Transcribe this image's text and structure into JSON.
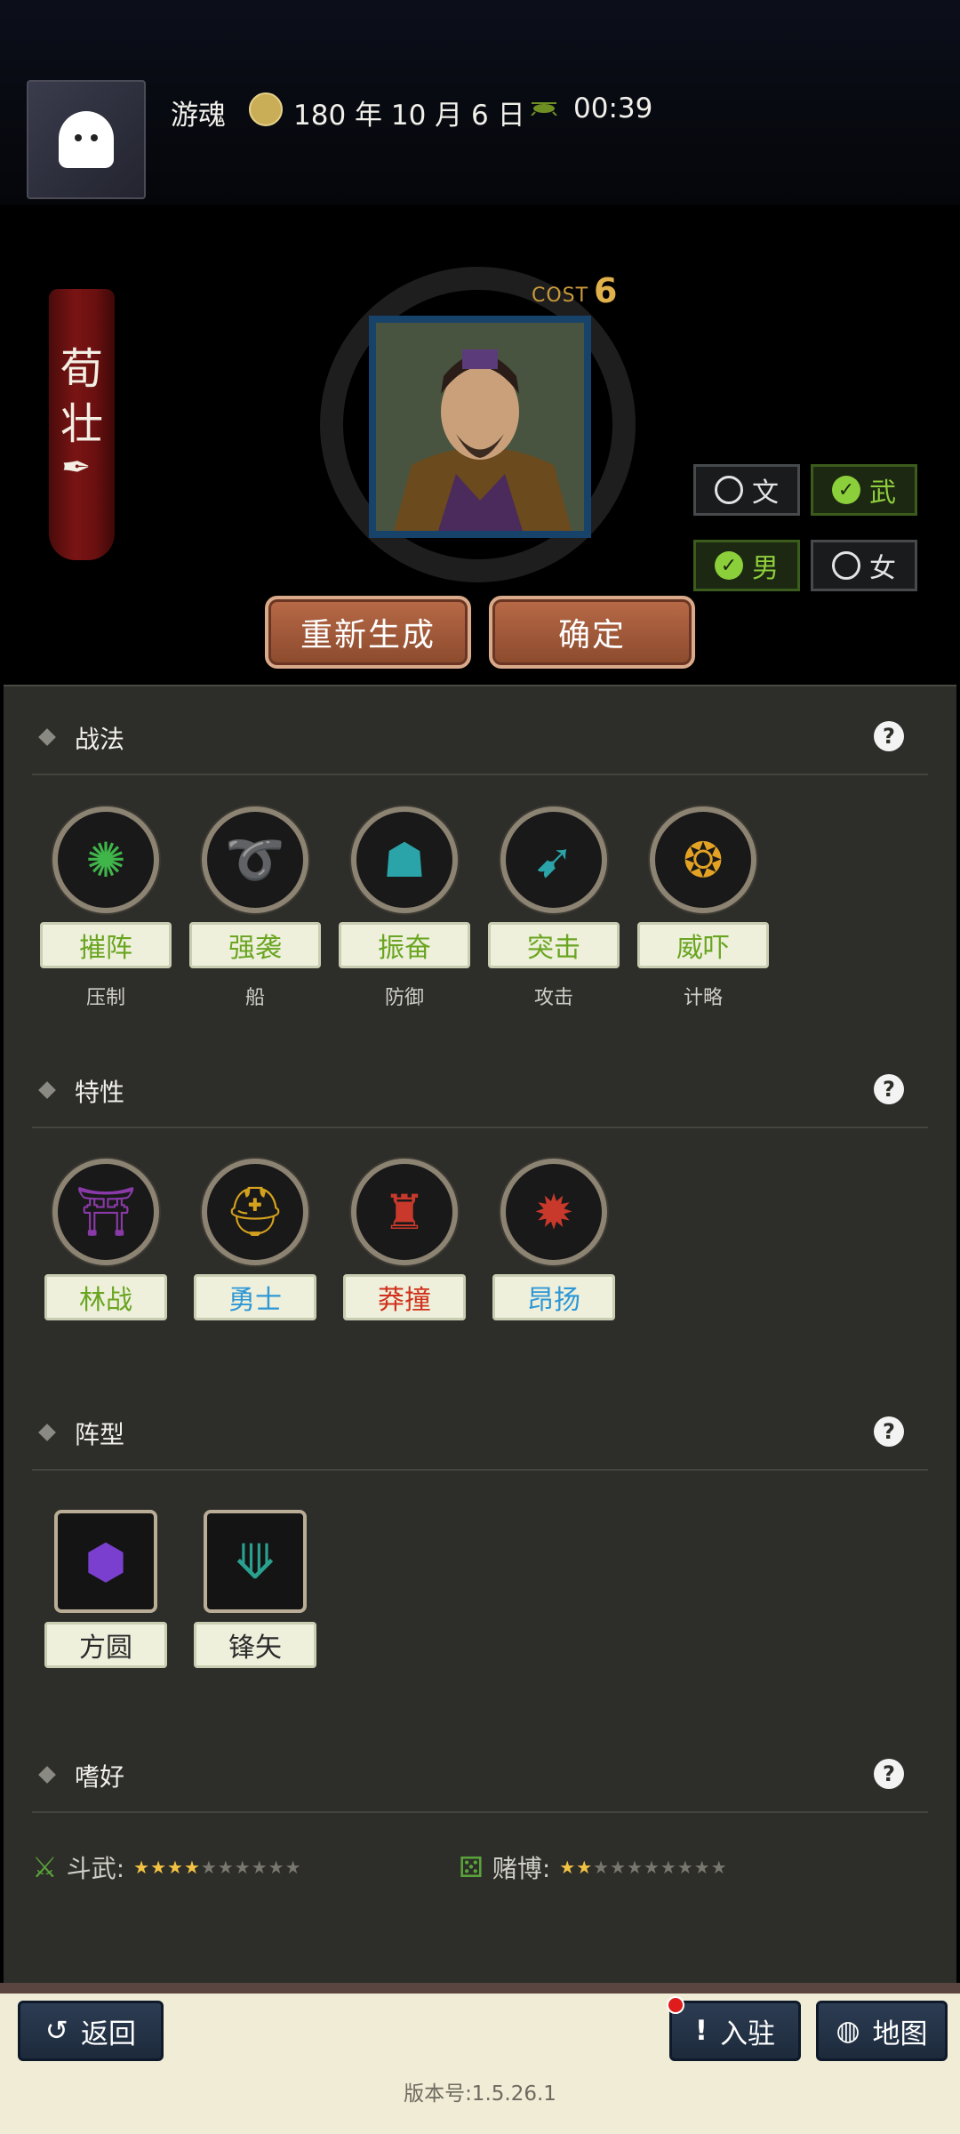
{
  "header": {
    "player_name": "游魂",
    "date": "180 年 10 月 6 日",
    "time": "00:39",
    "date_icon": "calendar-seal-icon",
    "time_icon": "cricket-icon"
  },
  "character": {
    "name_chars": [
      "荀",
      "壮"
    ],
    "name_icon": "quill-icon",
    "cost_label": "COST",
    "cost_value": "6"
  },
  "toggles": {
    "civil_label": "文",
    "military_label": "武",
    "male_label": "男",
    "female_label": "女",
    "civil_selected": false,
    "military_selected": true,
    "male_selected": true,
    "female_selected": false
  },
  "actions": {
    "regenerate_label": "重新生成",
    "confirm_label": "确定"
  },
  "tactics": {
    "title": "战法",
    "items": [
      {
        "name": "摧阵",
        "type": "压制",
        "icon": "shatter-icon"
      },
      {
        "name": "强袭",
        "type": "船",
        "icon": "assault-icon"
      },
      {
        "name": "振奋",
        "type": "防御",
        "icon": "rally-icon"
      },
      {
        "name": "突击",
        "type": "攻击",
        "icon": "charge-icon"
      },
      {
        "name": "威吓",
        "type": "计略",
        "icon": "roar-icon"
      }
    ]
  },
  "traits": {
    "title": "特性",
    "items": [
      {
        "name": "林战",
        "icon": "forest-icon"
      },
      {
        "name": "勇士",
        "icon": "helmet-icon"
      },
      {
        "name": "莽撞",
        "icon": "tree-trunk-icon"
      },
      {
        "name": "昂扬",
        "icon": "burst-icon"
      }
    ]
  },
  "formations": {
    "title": "阵型",
    "items": [
      {
        "name": "方圆",
        "icon": "turtle-shell-icon"
      },
      {
        "name": "锋矢",
        "icon": "arrowhead-icon"
      }
    ]
  },
  "hobbies": {
    "title": "嗜好",
    "items": [
      {
        "name": "斗武:",
        "icon": "crossed-swords-icon",
        "rating": 3.5,
        "max": 10
      },
      {
        "name": "赌博:",
        "icon": "dice-icon",
        "rating": 1.5,
        "max": 10
      }
    ]
  },
  "bottom": {
    "back_label": "返回",
    "enter_label": "入驻",
    "map_label": "地图",
    "version": "版本号:1.5.26.1"
  },
  "colors": {
    "label_green": "#6aa521",
    "label_blue": "#2e97d6",
    "label_red": "#d0311c",
    "label_dark": "#2b2b2b"
  }
}
